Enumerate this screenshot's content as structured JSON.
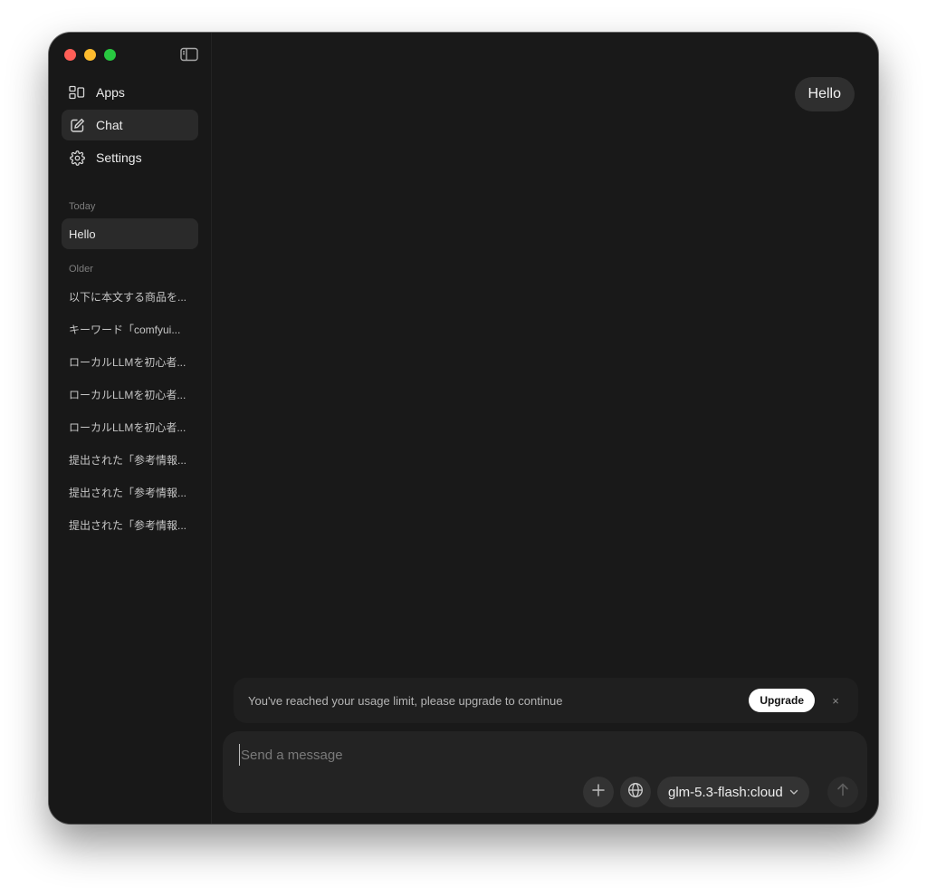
{
  "sidebar": {
    "nav": [
      {
        "label": "Apps",
        "icon": "apps-icon"
      },
      {
        "label": "Chat",
        "icon": "new-chat-icon"
      },
      {
        "label": "Settings",
        "icon": "gear-icon"
      }
    ],
    "today_label": "Today",
    "today_items": [
      "Hello"
    ],
    "older_label": "Older",
    "older_items": [
      "以下に本文する商品を...",
      "キーワード「comfyui...",
      "ローカルLLMを初心者...",
      "ローカルLLMを初心者...",
      "ローカルLLMを初心者...",
      "提出された「参考情報...",
      "提出された「参考情報...",
      "提出された「参考情報..."
    ]
  },
  "chat": {
    "user_message": "Hello"
  },
  "banner": {
    "text": "You've reached your usage limit, please upgrade to continue",
    "button_label": "Upgrade",
    "close_label": "×"
  },
  "composer": {
    "placeholder": "Send a message",
    "value": "",
    "model": "glm-5.3-flash:cloud"
  },
  "colors": {
    "window_bg": "#191919",
    "sidebar_bg": "#181818",
    "active_item_bg": "#2a2a2a",
    "bubble_bg": "#2f2f2f",
    "traffic_red": "#ff5f57",
    "traffic_yellow": "#febc2e",
    "traffic_green": "#28c840"
  }
}
